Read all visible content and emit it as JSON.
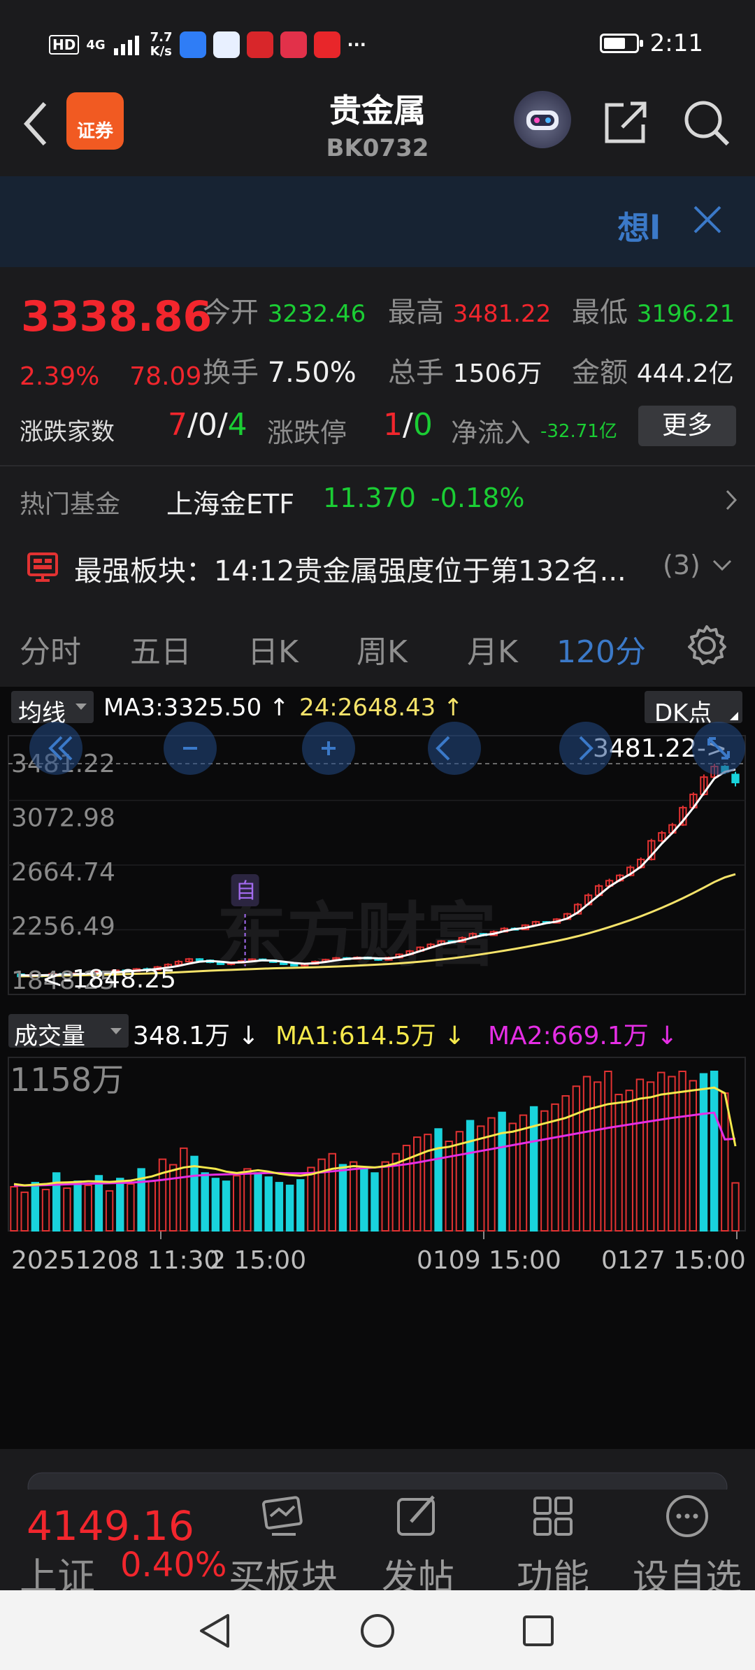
{
  "status_bar": {
    "hd": "HD",
    "net": "4G",
    "speed": "7.7\nK/s",
    "more": "···",
    "time": "2:11"
  },
  "header": {
    "logo_text": "证券",
    "title": "贵金属",
    "code": "BK0732"
  },
  "banner": {
    "text": "想l"
  },
  "quote": {
    "price": "3338.86",
    "change_pct": "2.39%",
    "change_val": "78.09",
    "open_label": "今开",
    "open": "3232.46",
    "high_label": "最高",
    "high": "3481.22",
    "low_label": "最低",
    "low": "3196.21",
    "turnover_label": "换手",
    "turnover": "7.50%",
    "volume_label": "总手",
    "volume": "1506万",
    "amount_label": "金额",
    "amount": "444.2亿",
    "updown_label": "涨跌家数",
    "up": "7",
    "flat": "0",
    "down": "4",
    "limit_label": "涨跌停",
    "limit_up": "1",
    "limit_down": "0",
    "netflow_label": "净流入",
    "netflow": "-32.71亿",
    "more_button": "更多"
  },
  "fund": {
    "label": "热门基金",
    "name": "上海金ETF",
    "price": "11.370",
    "change": "-0.18%"
  },
  "strongest": {
    "text": "最强板块：14:12贵金属强度位于第132名...",
    "count": "(3)"
  },
  "tabs": [
    "分时",
    "五日",
    "日K",
    "周K",
    "月K",
    "120分"
  ],
  "chart_header": {
    "ma_selector": "均线",
    "ma3": "MA3:3325.50",
    "ma24": "24:2648.43",
    "dk_button": "DK点"
  },
  "volume_header": {
    "selector": "成交量",
    "vol": "348.1万",
    "ma1": "MA1:614.5万",
    "ma2": "MA2:669.1万"
  },
  "chart_data": {
    "type": "candlestick",
    "y_ticks": [
      "3481.22",
      "3072.98",
      "2664.74",
      "2256.49",
      "1848.25"
    ],
    "high_marker": "3481.22->",
    "low_marker": "<-1848.25",
    "tag_label": "自",
    "volume_max_label": "1158万",
    "x_labels": [
      "20251208 11:30",
      "2 15:00",
      "0109 15:00",
      "0127 15:00"
    ],
    "ylim": [
      1848.25,
      3481.22
    ],
    "candles": [
      [
        1895,
        1878,
        1900,
        1875
      ],
      [
        1878,
        1890,
        1898,
        1870
      ],
      [
        1890,
        1880,
        1895,
        1872
      ],
      [
        1880,
        1898,
        1905,
        1876
      ],
      [
        1898,
        1886,
        1902,
        1880
      ],
      [
        1886,
        1900,
        1908,
        1882
      ],
      [
        1900,
        1893,
        1905,
        1888
      ],
      [
        1893,
        1912,
        1918,
        1890
      ],
      [
        1912,
        1905,
        1918,
        1899
      ],
      [
        1905,
        1925,
        1930,
        1901
      ],
      [
        1925,
        1918,
        1932,
        1912
      ],
      [
        1918,
        1935,
        1942,
        1914
      ],
      [
        1935,
        1928,
        1945,
        1922
      ],
      [
        1928,
        1950,
        1958,
        1925
      ],
      [
        1950,
        1968,
        1978,
        1945
      ],
      [
        1968,
        1990,
        2002,
        1962
      ],
      [
        1990,
        2010,
        2018,
        1985
      ],
      [
        2010,
        2000,
        2016,
        1994
      ],
      [
        2000,
        1985,
        2006,
        1978
      ],
      [
        1985,
        1970,
        1992,
        1965
      ],
      [
        1970,
        1982,
        1990,
        1962
      ],
      [
        1982,
        1995,
        2002,
        1976
      ],
      [
        1995,
        2008,
        2015,
        1990
      ],
      [
        2008,
        2000,
        2014,
        1994
      ],
      [
        2000,
        1986,
        2005,
        1980
      ],
      [
        1986,
        1970,
        1992,
        1964
      ],
      [
        1970,
        1960,
        1976,
        1955
      ],
      [
        1960,
        1972,
        1980,
        1954
      ],
      [
        1972,
        1990,
        1998,
        1968
      ],
      [
        1990,
        2005,
        2012,
        1985
      ],
      [
        2005,
        2018,
        2025,
        2000
      ],
      [
        2018,
        2010,
        2024,
        2004
      ],
      [
        2010,
        2022,
        2030,
        2006
      ],
      [
        2022,
        2015,
        2028,
        2010
      ],
      [
        2015,
        2002,
        2020,
        1996
      ],
      [
        2002,
        2020,
        2028,
        1998
      ],
      [
        2020,
        2045,
        2052,
        2015
      ],
      [
        2045,
        2070,
        2078,
        2040
      ],
      [
        2070,
        2098,
        2105,
        2064
      ],
      [
        2098,
        2120,
        2130,
        2092
      ],
      [
        2120,
        2145,
        2152,
        2115
      ],
      [
        2145,
        2138,
        2150,
        2130
      ],
      [
        2138,
        2170,
        2180,
        2132
      ],
      [
        2170,
        2200,
        2210,
        2165
      ],
      [
        2200,
        2188,
        2206,
        2180
      ],
      [
        2188,
        2215,
        2225,
        2184
      ],
      [
        2215,
        2240,
        2250,
        2210
      ],
      [
        2240,
        2232,
        2248,
        2226
      ],
      [
        2232,
        2265,
        2272,
        2228
      ],
      [
        2265,
        2290,
        2298,
        2258
      ],
      [
        2290,
        2282,
        2296,
        2276
      ],
      [
        2282,
        2310,
        2318,
        2278
      ],
      [
        2310,
        2350,
        2358,
        2305
      ],
      [
        2350,
        2420,
        2432,
        2345
      ],
      [
        2420,
        2490,
        2505,
        2412
      ],
      [
        2490,
        2560,
        2575,
        2482
      ],
      [
        2560,
        2600,
        2615,
        2548
      ],
      [
        2600,
        2640,
        2650,
        2590
      ],
      [
        2640,
        2700,
        2715,
        2632
      ],
      [
        2700,
        2760,
        2775,
        2690
      ],
      [
        2760,
        2900,
        2915,
        2752
      ],
      [
        2900,
        2960,
        2975,
        2890
      ],
      [
        2960,
        3020,
        3035,
        2950
      ],
      [
        3020,
        3150,
        3165,
        3012
      ],
      [
        3150,
        3250,
        3265,
        3140
      ],
      [
        3250,
        3380,
        3400,
        3240
      ],
      [
        3380,
        3460,
        3481.22,
        3370
      ],
      [
        3460,
        3420,
        3470,
        3405
      ],
      [
        3400,
        3338.86,
        3420,
        3310
      ]
    ],
    "ma_fast": [
      1888,
      1886,
      1888,
      1890,
      1893,
      1895,
      1898,
      1900,
      1905,
      1910,
      1916,
      1922,
      1928,
      1935,
      1945,
      1958,
      1975,
      1990,
      1995,
      1990,
      1982,
      1985,
      1992,
      2000,
      1998,
      1990,
      1980,
      1974,
      1978,
      1988,
      2000,
      2010,
      2016,
      2018,
      2015,
      2014,
      2025,
      2045,
      2070,
      2095,
      2120,
      2135,
      2150,
      2172,
      2190,
      2200,
      2220,
      2235,
      2245,
      2262,
      2280,
      2292,
      2315,
      2360,
      2425,
      2490,
      2555,
      2605,
      2650,
      2705,
      2790,
      2880,
      2960,
      3050,
      3150,
      3260,
      3370,
      3420,
      3438
    ],
    "ma_slow": [
      1880,
      1881,
      1882,
      1884,
      1885,
      1887,
      1888,
      1890,
      1892,
      1894,
      1896,
      1898,
      1900,
      1903,
      1906,
      1910,
      1914,
      1918,
      1922,
      1925,
      1928,
      1931,
      1934,
      1937,
      1940,
      1942,
      1944,
      1946,
      1948,
      1950,
      1953,
      1956,
      1960,
      1964,
      1968,
      1972,
      1977,
      1983,
      1990,
      1998,
      2006,
      2015,
      2025,
      2036,
      2048,
      2060,
      2073,
      2086,
      2100,
      2115,
      2130,
      2146,
      2163,
      2182,
      2203,
      2226,
      2250,
      2276,
      2303,
      2332,
      2363,
      2396,
      2431,
      2468,
      2507,
      2548,
      2590,
      2625,
      2648.43
    ],
    "volumes": [
      320,
      280,
      350,
      300,
      420,
      310,
      360,
      330,
      400,
      290,
      380,
      340,
      450,
      360,
      520,
      480,
      600,
      540,
      420,
      380,
      360,
      400,
      450,
      420,
      390,
      350,
      330,
      370,
      460,
      520,
      560,
      480,
      500,
      460,
      420,
      500,
      560,
      620,
      680,
      700,
      740,
      650,
      720,
      800,
      760,
      820,
      860,
      780,
      840,
      900,
      870,
      920,
      980,
      1050,
      1120,
      1080,
      1158,
      990,
      1020,
      1100,
      1080,
      1150,
      1120,
      1158,
      1090,
      1140,
      1158,
      1000,
      348.1
    ],
    "vol_colors": "rrgrgrgrgrgrgrrrrggggrrgggggrrrgrggrrrrrgrrgrrgrrgrrrrrrrrrrrrrrrgg",
    "vol_ma1": [
      340,
      330,
      335,
      340,
      350,
      352,
      355,
      360,
      358,
      355,
      360,
      365,
      380,
      395,
      420,
      440,
      460,
      470,
      460,
      450,
      430,
      420,
      430,
      440,
      430,
      415,
      405,
      400,
      410,
      430,
      450,
      460,
      470,
      465,
      460,
      470,
      490,
      520,
      550,
      580,
      600,
      610,
      630,
      650,
      670,
      690,
      710,
      720,
      740,
      760,
      780,
      800,
      820,
      850,
      880,
      900,
      920,
      930,
      940,
      960,
      970,
      990,
      1000,
      1010,
      1020,
      1030,
      1040,
      1000,
      614.5
    ],
    "vol_ma2": [
      330,
      328,
      330,
      332,
      335,
      338,
      340,
      342,
      344,
      346,
      348,
      350,
      355,
      362,
      370,
      380,
      390,
      400,
      405,
      408,
      410,
      412,
      415,
      418,
      420,
      420,
      418,
      418,
      420,
      425,
      432,
      440,
      448,
      455,
      460,
      466,
      474,
      484,
      496,
      510,
      524,
      538,
      552,
      566,
      580,
      594,
      608,
      622,
      636,
      650,
      664,
      678,
      692,
      706,
      720,
      734,
      748,
      760,
      772,
      784,
      796,
      808,
      820,
      830,
      840,
      850,
      858,
      664,
      669.1
    ]
  },
  "bottom": {
    "index_value": "4149.16",
    "index_name": "上证",
    "index_pct": "0.40%",
    "items": [
      "买板块",
      "发帖",
      "功能",
      "设自选"
    ]
  },
  "colors": {
    "up": "#f2262d",
    "down": "#1bcd34",
    "accent": "#3b79c8",
    "candle_up": "#e23232",
    "candle_down": "#19d3dc",
    "ma_fast": "#ffffff",
    "ma_slow": "#f5e36a",
    "vol_ma1": "#f5e94c",
    "vol_ma2": "#e52ee5"
  }
}
